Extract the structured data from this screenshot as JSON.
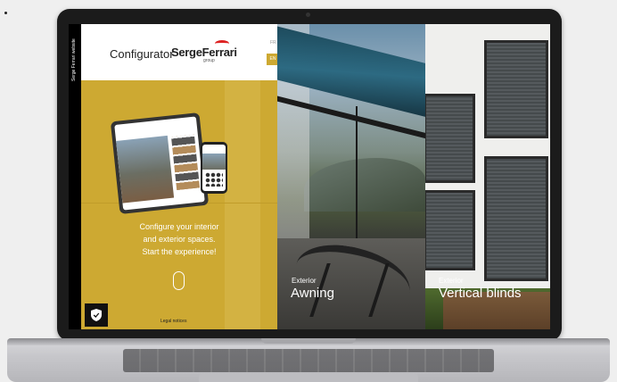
{
  "left_panel": {
    "side_label": "Serge Ferrari website",
    "title": "Configurator",
    "brand": "SergeFerrari",
    "brand_sub": "group",
    "languages": [
      "FR",
      "EN"
    ],
    "cta_lines": [
      "Configure your interior",
      "and exterior spaces.",
      "Start the experience!"
    ],
    "legal_link": "Legal notices",
    "accent_color": "#cda932"
  },
  "panels": [
    {
      "subtitle": "Exterior",
      "title": "Awning"
    },
    {
      "subtitle": "Exterior",
      "title": "Vertical blinds"
    }
  ],
  "icons": {
    "privacy": "shield-check-icon",
    "scroll": "scroll-pill-icon"
  }
}
